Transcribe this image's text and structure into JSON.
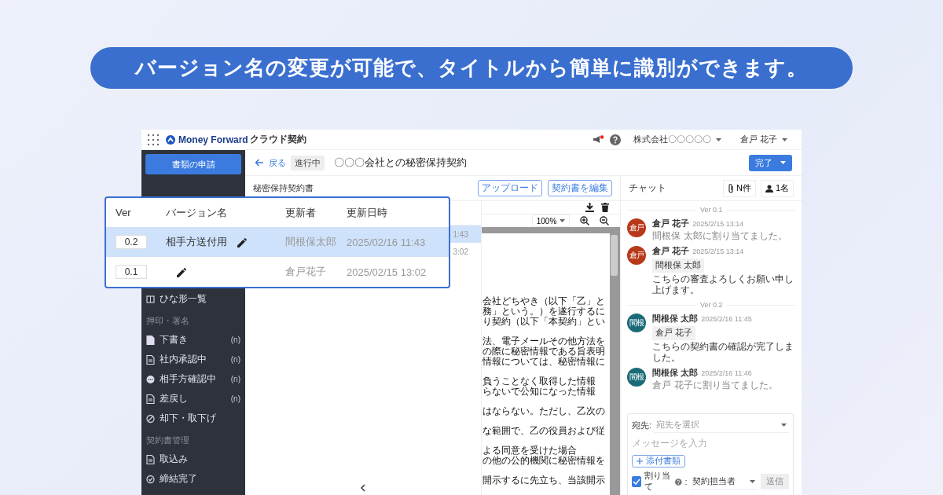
{
  "banner": {
    "text": "バージョン名の変更が可能で、タイトルから簡単に識別ができます。"
  },
  "topbar": {
    "brand": "Money Forward",
    "product": "クラウド契約",
    "has_notice": true,
    "company": "株式会社〇〇〇〇〇",
    "user": "倉戸 花子"
  },
  "sidebar": {
    "apply_button": "書類の申請",
    "items": [
      {
        "kind": "item",
        "label": "ひな形一覧"
      },
      {
        "kind": "section",
        "label": "押印・署名"
      },
      {
        "kind": "item",
        "label": "下書き",
        "count": "(n)"
      },
      {
        "kind": "item",
        "label": "社内承認中",
        "count": "(n)"
      },
      {
        "kind": "item",
        "label": "相手方確認中",
        "count": "(n)"
      },
      {
        "kind": "item",
        "label": "差戻し",
        "count": "(n)"
      },
      {
        "kind": "item",
        "label": "却下・取下げ"
      },
      {
        "kind": "section",
        "label": "契約書管理"
      },
      {
        "kind": "item",
        "label": "取込み"
      },
      {
        "kind": "item",
        "label": "締結完了"
      }
    ]
  },
  "header": {
    "back": "戻る",
    "status": "進行中",
    "title": "〇〇〇会社との秘密保持契約",
    "complete_button": "完了"
  },
  "document": {
    "name": "秘密保持契約書",
    "buttons": [
      "アップロード",
      "契約書を編集"
    ]
  },
  "version_list": {
    "rows": [
      {
        "time": "1:43",
        "selected": true
      },
      {
        "time": "3:02",
        "selected": false
      }
    ]
  },
  "viewer": {
    "zoom": "100%",
    "paragraphs": [
      [
        "会社どちやき（以下「乙」と",
        "務」という。）を遂行するに",
        "り契約（以下「本契約」とい"
      ],
      [
        "法、電子メールその他方法を",
        "の際に秘密情報である旨表明",
        "情報については、秘密情報に"
      ],
      [
        "負うことなく取得した情報",
        "らないで公知になった情報"
      ],
      [
        "はならない。ただし、乙次の"
      ],
      [
        "な範囲で、乙の役員および従"
      ],
      [
        "よる同意を受けた場合",
        "の他の公的機関に秘密情報を"
      ],
      [
        "開示するに先立ち、当該開示"
      ]
    ]
  },
  "chat": {
    "title": "チャット",
    "attachments": "N件",
    "members": "1名",
    "entries": [
      {
        "kind": "divider",
        "label": "Ver 0.1"
      },
      {
        "kind": "message",
        "initials": "倉戸",
        "color": "#b8391a",
        "name": "倉戸 花子",
        "time": "2025/2/15 13:14",
        "text": "間根保 太郎に割り当てました。",
        "system": true
      },
      {
        "kind": "message",
        "initials": "倉戸",
        "color": "#b8391a",
        "name": "倉戸 花子",
        "time": "2025/2/15 13:14",
        "mention": "間根保 太郎",
        "text": "こちらの審査よろしくお願い申し上げます。",
        "system": false
      },
      {
        "kind": "divider",
        "label": "Ver 0.2"
      },
      {
        "kind": "message",
        "initials": "間根",
        "color": "#1b6a78",
        "name": "間根保 太郎",
        "time": "2025/2/16 11:45",
        "mention": "倉戸 花子",
        "text": "こちらの契約書の確認が完了しました。",
        "system": false
      },
      {
        "kind": "message",
        "initials": "間根",
        "color": "#1b6a78",
        "name": "間根保 太郎",
        "time": "2025/2/16 11:46",
        "text": "倉戸 花子に割り当てました。",
        "system": true
      }
    ]
  },
  "composer": {
    "to_label": "宛先:",
    "to_placeholder": "宛先を選択",
    "message_placeholder": "メッセージを入力",
    "attach_button": "添付書類",
    "assign": {
      "label": "割り当て",
      "checked": true,
      "separator": ":",
      "value": "契約担当者"
    },
    "send_button": "送信",
    "send_disabled": true
  },
  "version_popup": {
    "columns": [
      "Ver",
      "バージョン名",
      "更新者",
      "更新日時"
    ],
    "rows": [
      {
        "ver": "0.2",
        "name": "相手方送付用",
        "updater": "間根保太郎",
        "updated": "2025/02/16 11:43",
        "selected": true
      },
      {
        "ver": "0.1",
        "updater": "倉戸花子",
        "updated": "2025/02/15 13:02",
        "selected": false
      }
    ]
  }
}
